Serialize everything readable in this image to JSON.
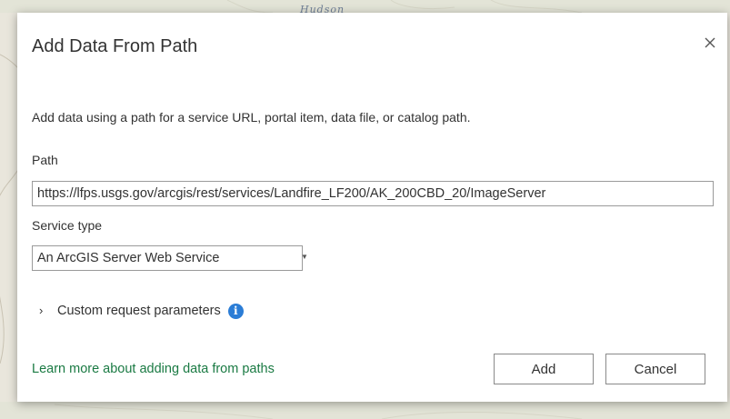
{
  "map": {
    "label": "Hudson"
  },
  "dialog": {
    "title": "Add Data From Path",
    "close_icon": "close-icon",
    "description": "Add data using a path for a service URL, portal item, data file, or catalog path.",
    "path": {
      "label": "Path",
      "value": "https://lfps.usgs.gov/arcgis/rest/services/Landfire_LF200/AK_200CBD_20/ImageServer"
    },
    "service_type": {
      "label": "Service type",
      "selected": "An ArcGIS Server Web Service"
    },
    "custom_params": {
      "label": "Custom request parameters",
      "expand_icon": "chevron-right-icon",
      "info_icon": "info-icon"
    },
    "learn_more": "Learn more about adding data from paths",
    "buttons": {
      "add": "Add",
      "cancel": "Cancel"
    }
  },
  "colors": {
    "link": "#1a7a43",
    "info": "#2b7dd6",
    "text": "#323232"
  }
}
